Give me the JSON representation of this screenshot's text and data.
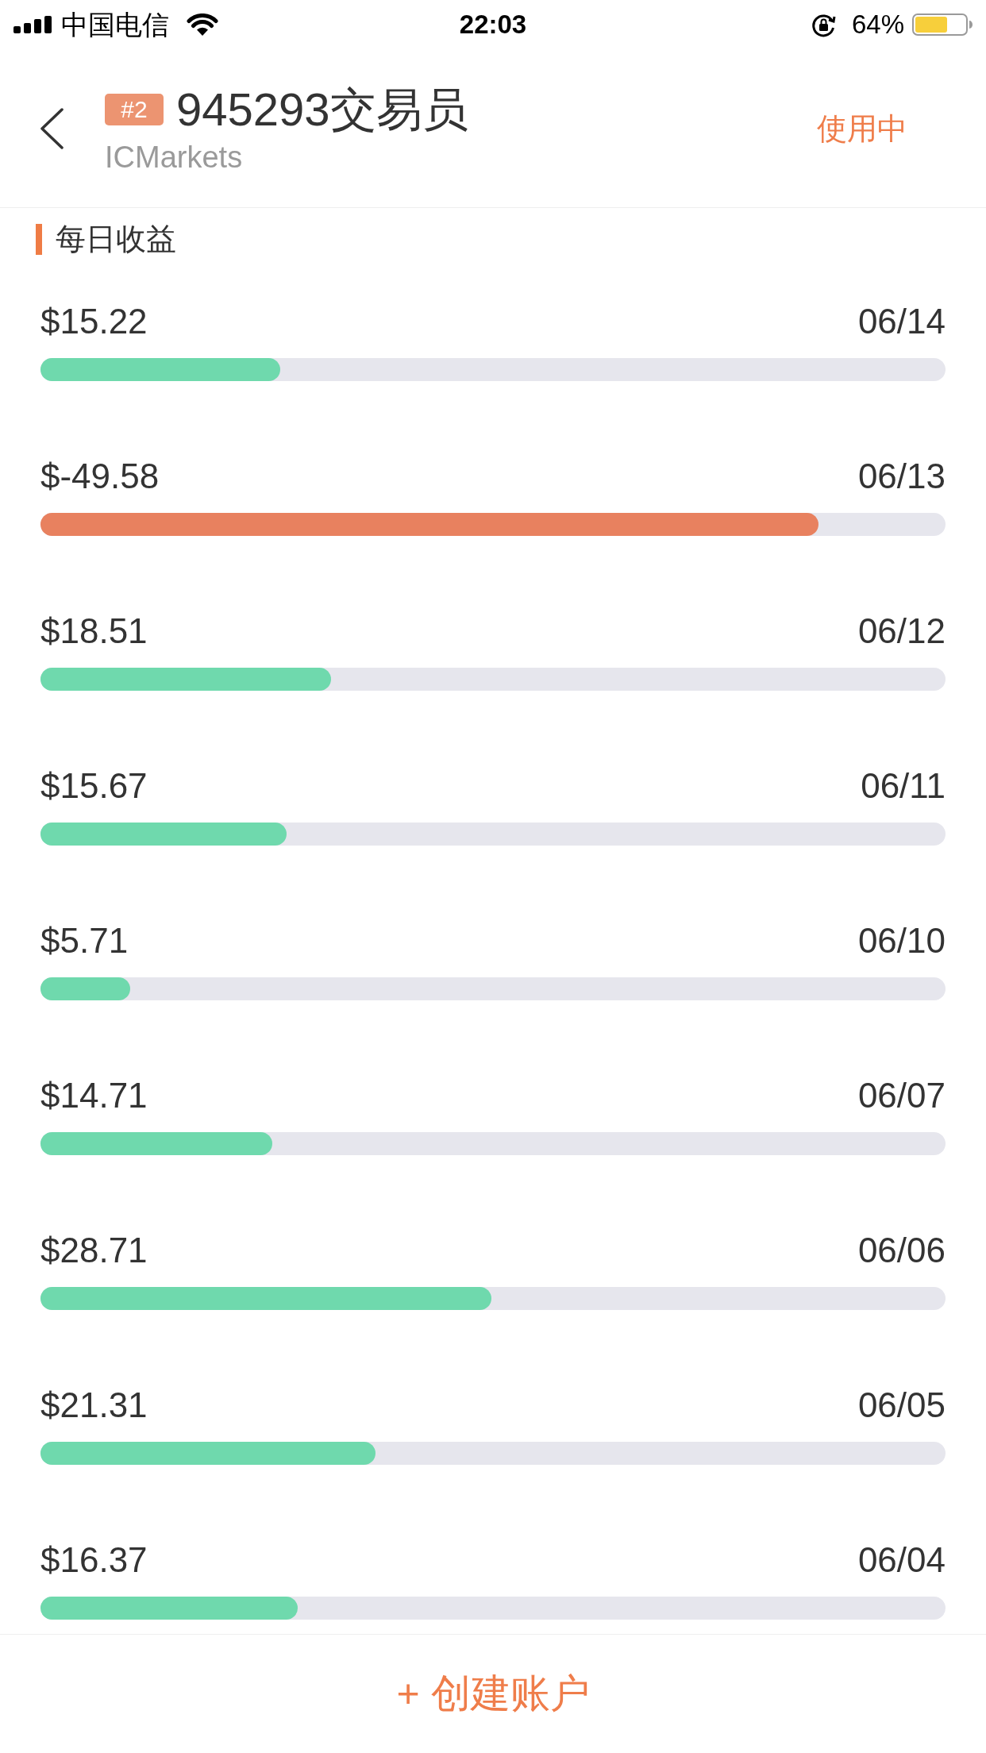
{
  "status_bar": {
    "carrier": "中国电信",
    "time": "22:03",
    "battery": "64%"
  },
  "header": {
    "badge": "#2",
    "title": "945293交易员",
    "subtitle": "ICMarkets",
    "status": "使用中"
  },
  "section": {
    "title": "每日收益"
  },
  "rows": [
    {
      "amount": "$15.22",
      "date": "06/14",
      "level": 0.265,
      "color": "#6fd9ad"
    },
    {
      "amount": "$-49.58",
      "date": "06/13",
      "level": 0.86,
      "color": "#e8815f"
    },
    {
      "amount": "$18.51",
      "date": "06/12",
      "level": 0.321,
      "color": "#6fd9ad"
    },
    {
      "amount": "$15.67",
      "date": "06/11",
      "level": 0.272,
      "color": "#6fd9ad"
    },
    {
      "amount": "$5.71",
      "date": "06/10",
      "level": 0.099,
      "color": "#6fd9ad"
    },
    {
      "amount": "$14.71",
      "date": "06/07",
      "level": 0.256,
      "color": "#6fd9ad"
    },
    {
      "amount": "$28.71",
      "date": "06/06",
      "level": 0.498,
      "color": "#6fd9ad"
    },
    {
      "amount": "$21.31",
      "date": "06/05",
      "level": 0.37,
      "color": "#6fd9ad"
    },
    {
      "amount": "$16.37",
      "date": "06/04",
      "level": 0.284,
      "color": "#6fd9ad"
    }
  ],
  "footer": {
    "button": "+ 创建账户"
  }
}
